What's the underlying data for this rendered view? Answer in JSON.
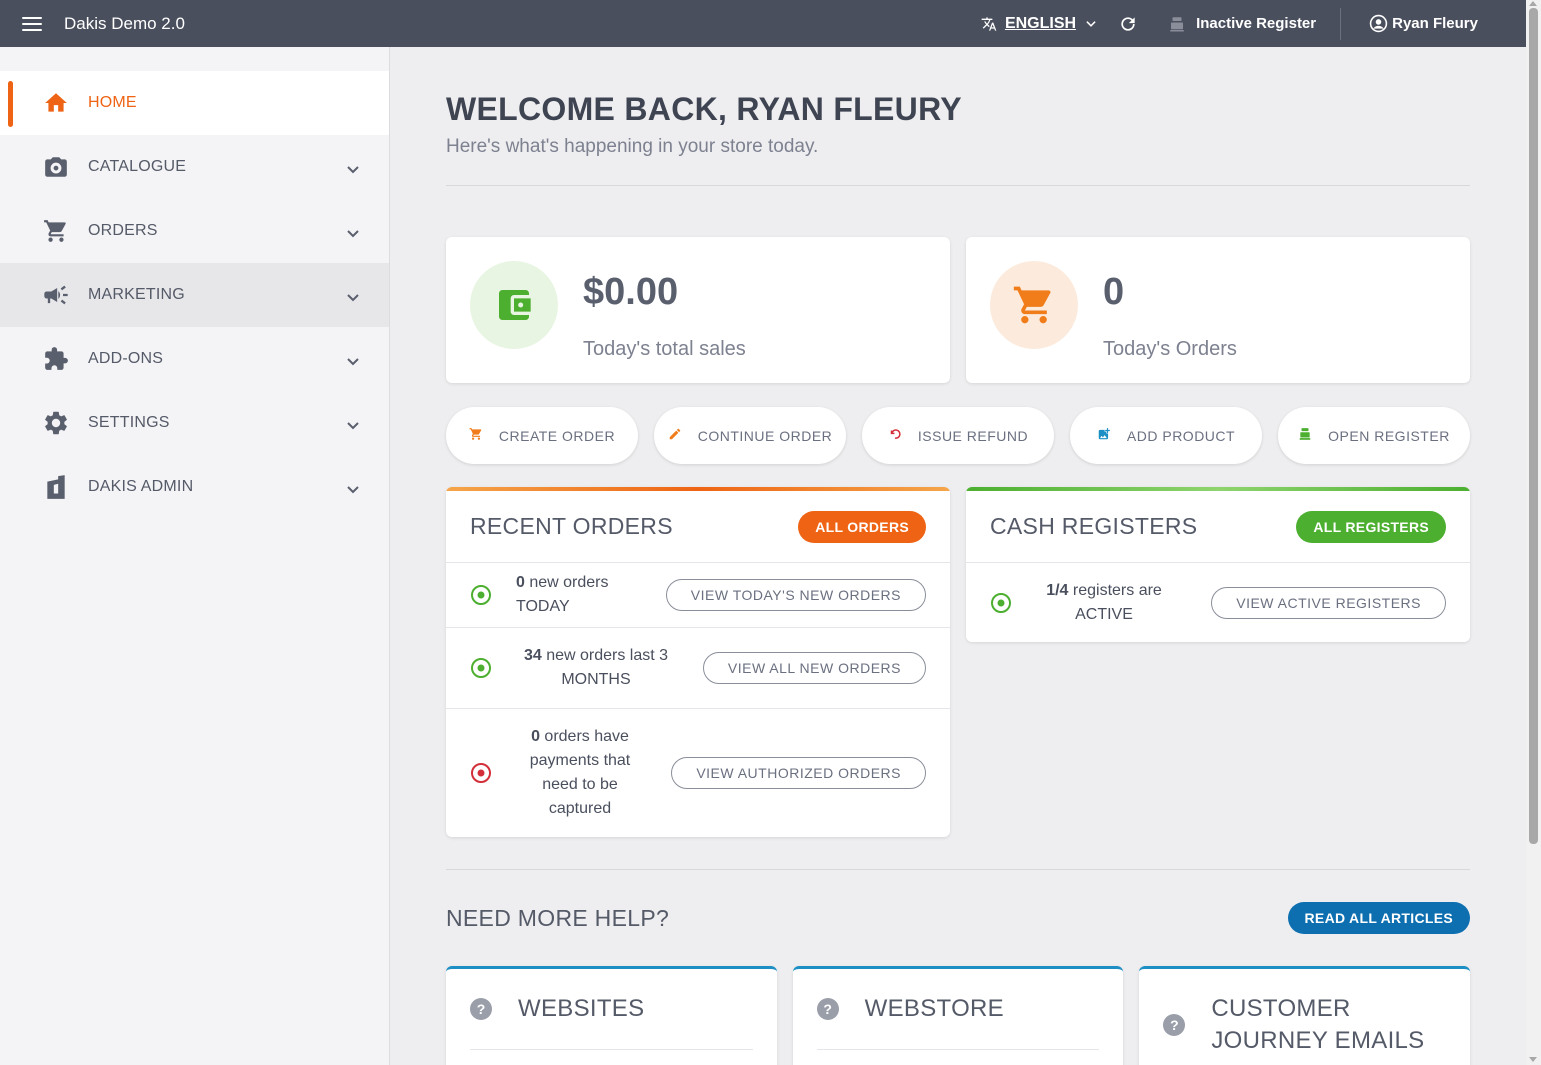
{
  "topbar": {
    "app_title": "Dakis Demo 2.0",
    "language": "ENGLISH",
    "register_status": "Inactive Register",
    "user_name": "Ryan Fleury"
  },
  "sidebar": {
    "items": [
      {
        "label": "HOME",
        "icon": "home-icon",
        "active": true
      },
      {
        "label": "CATALOGUE",
        "icon": "camera-icon"
      },
      {
        "label": "ORDERS",
        "icon": "cart-icon"
      },
      {
        "label": "MARKETING",
        "icon": "megaphone-icon"
      },
      {
        "label": "ADD-ONS",
        "icon": "puzzle-icon"
      },
      {
        "label": "SETTINGS",
        "icon": "gear-icon"
      },
      {
        "label": "DAKIS ADMIN",
        "icon": "admin-icon"
      }
    ]
  },
  "main": {
    "welcome": "WELCOME BACK, RYAN FLEURY",
    "subtitle": "Here's what's happening in your store today.",
    "stats": {
      "sales_value": "$0.00",
      "sales_label": "Today's total sales",
      "orders_value": "0",
      "orders_label": "Today's Orders"
    },
    "actions": {
      "create_order": "CREATE ORDER",
      "continue_order": "CONTINUE ORDER",
      "issue_refund": "ISSUE REFUND",
      "add_product": "ADD PRODUCT",
      "open_register": "OPEN REGISTER"
    },
    "recent_orders": {
      "title": "RECENT ORDERS",
      "all_button": "ALL ORDERS",
      "rows": [
        {
          "count": "0",
          "text": "new orders TODAY",
          "button": "VIEW TODAY'S NEW ORDERS"
        },
        {
          "count": "34",
          "text": "new orders last 3 MONTHS",
          "button": "VIEW ALL NEW ORDERS"
        },
        {
          "count": "0",
          "text": "orders have payments that need to be captured",
          "button": "VIEW AUTHORIZED ORDERS"
        }
      ]
    },
    "cash_registers": {
      "title": "CASH REGISTERS",
      "all_button": "ALL REGISTERS",
      "count": "1/4",
      "text": "registers are ACTIVE",
      "button": "VIEW ACTIVE REGISTERS"
    },
    "help": {
      "title": "NEED MORE HELP?",
      "read_all": "READ ALL ARTICLES",
      "cards": [
        "WEBSITES",
        "WEBSTORE",
        "CUSTOMER JOURNEY EMAILS"
      ]
    }
  },
  "colors": {
    "topbar": "#4a4f5e",
    "accent_orange": "#ee6414",
    "accent_green": "#4caf30",
    "accent_blue": "#0d6fb0",
    "status_red": "#d32f3a"
  }
}
